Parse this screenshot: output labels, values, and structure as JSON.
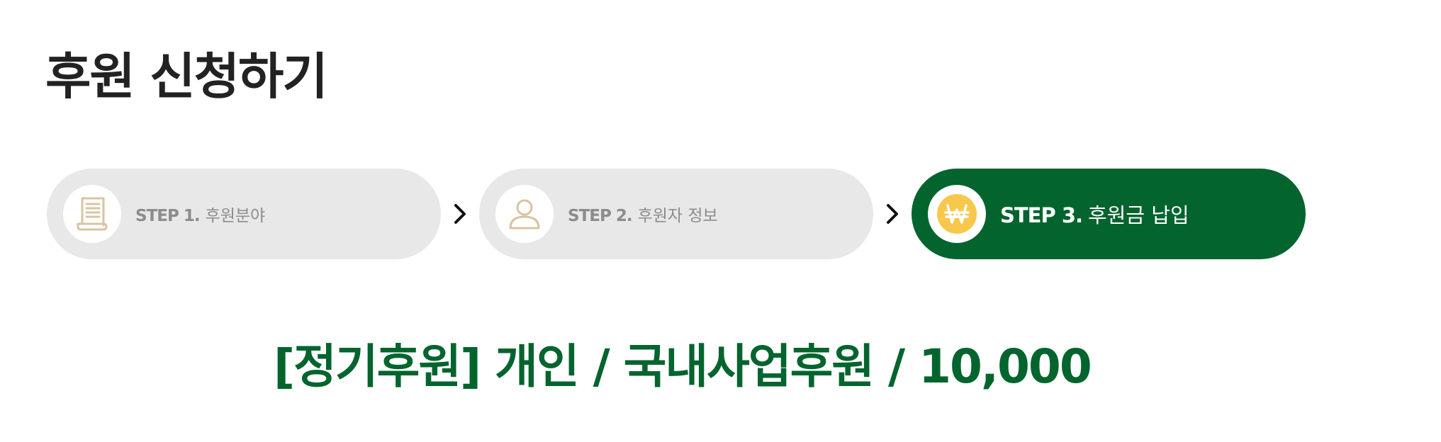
{
  "page": {
    "title": "후원 신청하기"
  },
  "steps": [
    {
      "number": "STEP 1.",
      "label": "후원분야",
      "icon": "document-icon",
      "active": false
    },
    {
      "number": "STEP 2.",
      "label": "후원자 정보",
      "icon": "person-icon",
      "active": false
    },
    {
      "number": "STEP 3.",
      "label": "후원금 납입",
      "icon": "won-coin-icon",
      "active": true
    }
  ],
  "summary": {
    "text": "[정기후원] 개인 / 국내사업후원 / 10,000"
  },
  "colors": {
    "accent": "#03642e",
    "step_inactive_bg": "#e8e8e8",
    "step_inactive_text": "#8c8c8c",
    "icon_beige": "#d9c4a0",
    "coin_yellow": "#f8c84c",
    "title_text": "#222222"
  }
}
